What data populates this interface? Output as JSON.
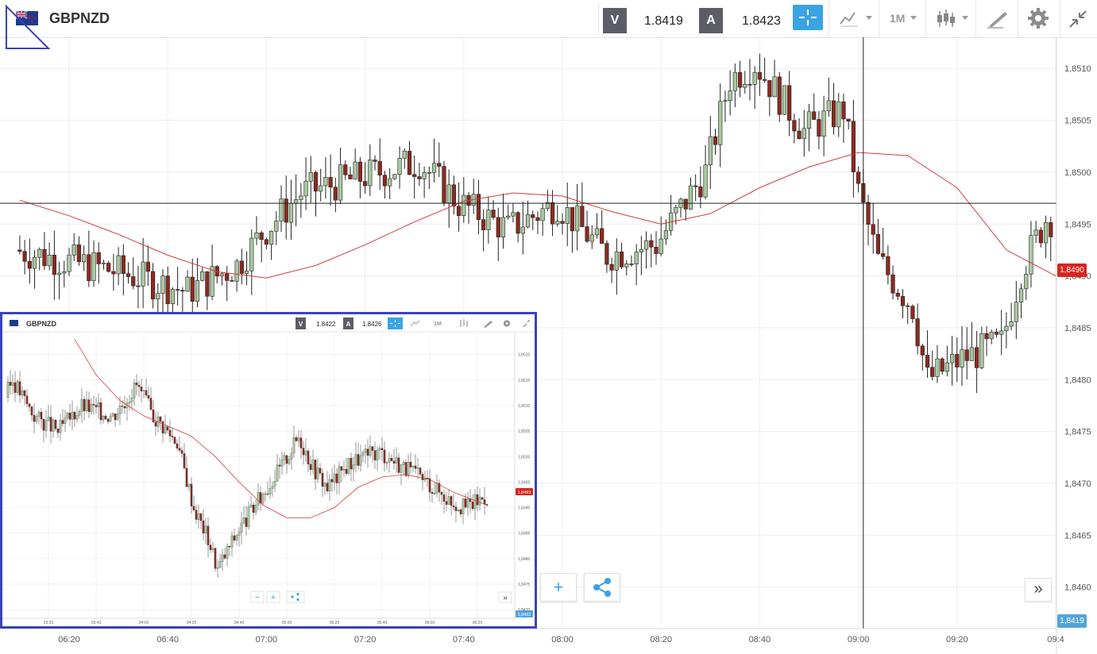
{
  "header": {
    "symbol": "GBPNZD",
    "bid_badge": "V",
    "bid_price": "1.8419",
    "ask_badge": "A",
    "ask_price": "1.8423",
    "timeframe": "1M",
    "icons": [
      "flag-icon",
      "crosshair-icon",
      "line-chart-icon",
      "candlestick-icon",
      "draw-icon",
      "gear-icon",
      "collapse-icon"
    ]
  },
  "price_tags": {
    "last": "1,8490",
    "bottom": "1,8419"
  },
  "buttons": {
    "plus": "+",
    "expand": "»"
  },
  "chart_data": [
    {
      "type": "candlestick",
      "title": "",
      "x_ticks": [
        "06:20",
        "06:40",
        "07:00",
        "07:20",
        "07:40",
        "08:00",
        "08:20",
        "08:40",
        "09:00",
        "09:20",
        "09:4"
      ],
      "y_ticks": [
        "1,8510",
        "1,8505",
        "1,8500",
        "1,8495",
        "1,8490",
        "1,8485",
        "1,8480",
        "1,8475",
        "1,8470",
        "1,8465",
        "1,8460"
      ],
      "ylim": [
        1.8456,
        1.8513
      ],
      "grid": true,
      "horizontal_line": 1.8497,
      "crosshair_time": "09:01",
      "ma_series": [
        {
          "t": "06:10",
          "v": 1.84973
        },
        {
          "t": "06:20",
          "v": 1.84958
        },
        {
          "t": "06:30",
          "v": 1.8494
        },
        {
          "t": "06:40",
          "v": 1.8492
        },
        {
          "t": "06:50",
          "v": 1.84904
        },
        {
          "t": "07:00",
          "v": 1.84898
        },
        {
          "t": "07:10",
          "v": 1.8491
        },
        {
          "t": "07:20",
          "v": 1.8493
        },
        {
          "t": "07:30",
          "v": 1.84952
        },
        {
          "t": "07:40",
          "v": 1.84972
        },
        {
          "t": "07:50",
          "v": 1.8498
        },
        {
          "t": "08:00",
          "v": 1.84977
        },
        {
          "t": "08:10",
          "v": 1.84962
        },
        {
          "t": "08:20",
          "v": 1.8495
        },
        {
          "t": "08:30",
          "v": 1.8496
        },
        {
          "t": "08:40",
          "v": 1.84985
        },
        {
          "t": "08:50",
          "v": 1.85005
        },
        {
          "t": "09:00",
          "v": 1.85019
        },
        {
          "t": "09:10",
          "v": 1.85016
        },
        {
          "t": "09:20",
          "v": 1.84985
        },
        {
          "t": "09:30",
          "v": 1.84925
        },
        {
          "t": "09:40",
          "v": 1.849
        }
      ]
    },
    {
      "type": "candlestick",
      "title": "GBPNZD",
      "bid_badge": "V",
      "bid_price": "1.8422",
      "ask_badge": "A",
      "ask_price": "1.8426",
      "timeframe": "1M",
      "x_ticks": [
        "03:20",
        "03:40",
        "04:00",
        "04:20",
        "04:40",
        "05:00",
        "05:20",
        "05:40",
        "06:00",
        "06:20"
      ],
      "y_ticks": [
        "1,8520",
        "1,8515",
        "1,8510",
        "1,8505",
        "1,8500",
        "1,8495",
        "1,8490",
        "1,8485",
        "1,8480",
        "1,8475",
        "1,8470"
      ],
      "ylim": [
        1.8468,
        1.8524
      ],
      "last_price_tag": "1,8493",
      "bottom_price_tag": "1,8422",
      "zoom_minus": "−",
      "zoom_plus": "+",
      "expand": "»"
    }
  ]
}
